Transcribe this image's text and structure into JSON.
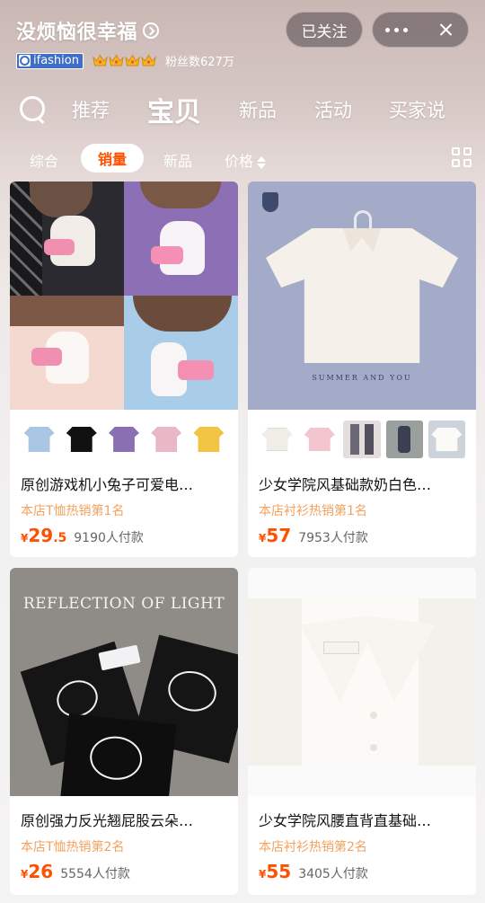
{
  "shop": {
    "name": "没烦恼很幸福",
    "brand_badge": "ifashion",
    "followers": "粉丝数627万",
    "follow_label": "已关注"
  },
  "nav": {
    "tabs": [
      "推荐",
      "宝贝",
      "新品",
      "活动",
      "买家说"
    ],
    "active": "宝贝"
  },
  "filters": {
    "items": [
      "综合",
      "销量",
      "新品",
      "价格"
    ],
    "active": "销量"
  },
  "products": [
    {
      "title": "原创游戏机小兔子可爱电…",
      "rank": "本店T恤热销第1名",
      "currency": "¥",
      "price_int": "29",
      "price_dec": ".5",
      "paid": "9190人付款"
    },
    {
      "title": "少女学院风基础款奶白色…",
      "rank": "本店衬衫热销第1名",
      "currency": "¥",
      "price_int": "57",
      "price_dec": "",
      "paid": "7953人付款",
      "image_caption": "SUMMER AND YOU"
    },
    {
      "title": "原创强力反光翘屁股云朵…",
      "rank": "本店T恤热销第2名",
      "currency": "¥",
      "price_int": "26",
      "price_dec": "",
      "paid": "5554人付款",
      "image_caption": "REFLECTION OF LIGHT"
    },
    {
      "title": "少女学院风腰直背直基础…",
      "rank": "本店衬衫热销第2名",
      "currency": "¥",
      "price_int": "55",
      "price_dec": "",
      "paid": "3405人付款"
    }
  ],
  "colors": {
    "accent": "#ff5000",
    "rank": "#f5a15c",
    "brand_badge": "#3f6ec8"
  }
}
